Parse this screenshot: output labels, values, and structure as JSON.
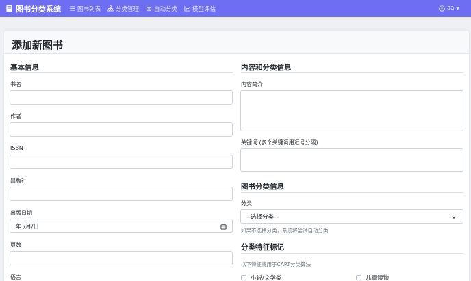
{
  "navbar": {
    "brand": "图书分类系统",
    "links": [
      {
        "label": "图书列表",
        "icon": "list-icon"
      },
      {
        "label": "分类管理",
        "icon": "tree-icon"
      },
      {
        "label": "自动分类",
        "icon": "robot-icon"
      },
      {
        "label": "模型评估",
        "icon": "chart-icon"
      }
    ],
    "user": "aa"
  },
  "page": {
    "title": "添加新图书"
  },
  "basic_info": {
    "title": "基本信息",
    "fields": [
      {
        "label": "书名",
        "value": ""
      },
      {
        "label": "作者",
        "value": ""
      },
      {
        "label": "ISBN",
        "value": ""
      },
      {
        "label": "出版社",
        "value": ""
      },
      {
        "label": "出版日期",
        "value": "年 /月/日"
      },
      {
        "label": "页数",
        "value": ""
      },
      {
        "label": "语言",
        "value": ""
      }
    ]
  },
  "content_info": {
    "title": "内容和分类信息",
    "summary_label": "内容简介",
    "keywords_label": "关键词 (多个关键词用逗号分隔)"
  },
  "classification": {
    "title": "图书分类信息",
    "category_label": "分类",
    "category_selected": "--选择分类--",
    "help": "如果不选择分类，系统将尝试自动分类"
  },
  "features": {
    "title": "分类特征标记",
    "note": "以下特征将用于CART分类算法",
    "options": [
      {
        "label": "小说/文学类",
        "checked": false
      },
      {
        "label": "儿童读物",
        "checked": false
      }
    ]
  },
  "colors": {
    "navbar": "#6e6ef2",
    "border": "#ced4da"
  }
}
